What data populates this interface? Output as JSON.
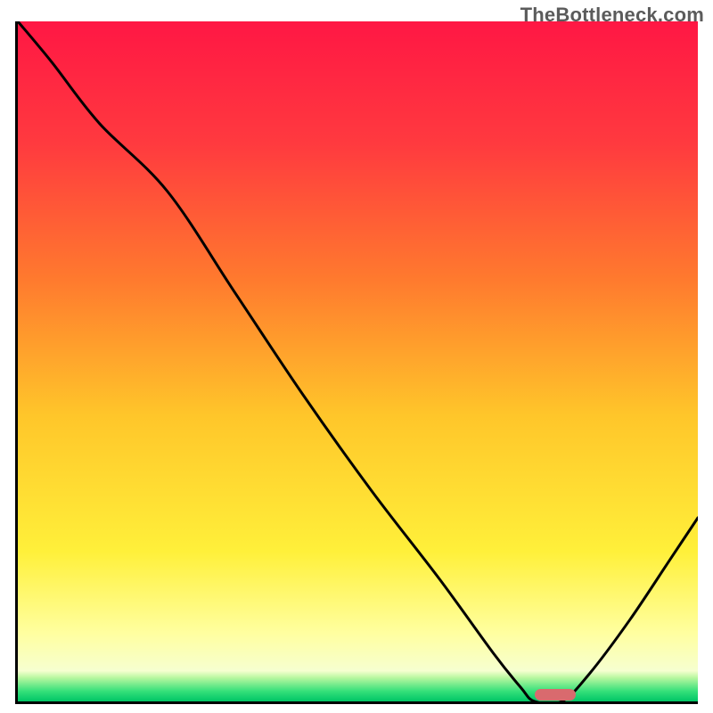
{
  "watermark": "TheBottleneck.com",
  "chart_data": {
    "type": "line",
    "title": "",
    "xlabel": "",
    "ylabel": "",
    "xlim": [
      0,
      100
    ],
    "ylim": [
      0,
      100
    ],
    "background": {
      "type": "vertical-gradient",
      "description": "red→orange→yellow→pale-yellow→thin-green band at bottom",
      "stops": [
        {
          "pos": 0.0,
          "color": "#ff1744"
        },
        {
          "pos": 0.18,
          "color": "#ff3a3f"
        },
        {
          "pos": 0.38,
          "color": "#ff7a2e"
        },
        {
          "pos": 0.58,
          "color": "#ffc62a"
        },
        {
          "pos": 0.78,
          "color": "#fff03a"
        },
        {
          "pos": 0.9,
          "color": "#ffffa0"
        },
        {
          "pos": 0.955,
          "color": "#f6ffd0"
        },
        {
          "pos": 0.965,
          "color": "#b9f7a0"
        },
        {
          "pos": 0.985,
          "color": "#35e07a"
        },
        {
          "pos": 1.0,
          "color": "#00c566"
        }
      ]
    },
    "series": [
      {
        "name": "bottleneck-curve",
        "color": "#000000",
        "x": [
          0,
          5,
          12,
          22,
          32,
          42,
          52,
          62,
          70,
          74,
          76,
          80,
          84,
          90,
          96,
          100
        ],
        "y": [
          100,
          94,
          85,
          75,
          60,
          45,
          31,
          18,
          7,
          2,
          0,
          0,
          4,
          12,
          21,
          27
        ]
      }
    ],
    "marker": {
      "name": "optimal-range",
      "x_start": 76,
      "x_end": 82,
      "y": 0,
      "color": "#d96a6e"
    }
  }
}
